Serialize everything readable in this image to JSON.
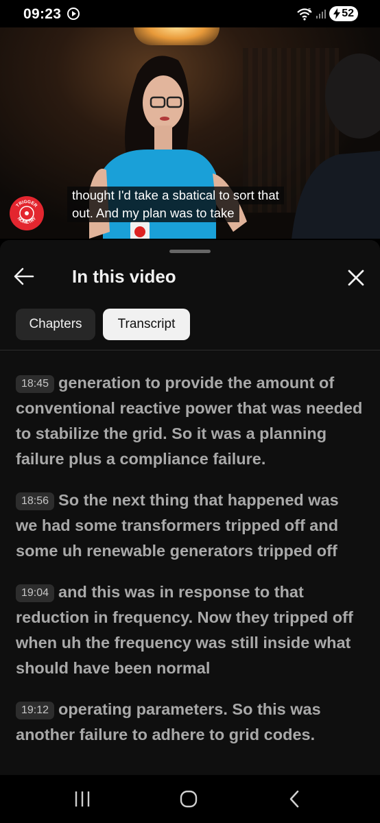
{
  "status_bar": {
    "time": "09:23",
    "battery": "52",
    "wifi_badge": "5"
  },
  "video": {
    "subtitle_lines": [
      "thought I'd take a sbatical to sort that",
      "out. And my plan was to take"
    ],
    "channel_badge_text": [
      "TRIGGER",
      "NOMETRY"
    ]
  },
  "panel": {
    "title": "In this video",
    "tabs": [
      {
        "label": "Chapters",
        "selected": false
      },
      {
        "label": "Transcript",
        "selected": true
      }
    ]
  },
  "transcript": [
    {
      "time": "18:45",
      "text": "generation to provide the amount of conventional reactive power that was needed to stabilize the grid. So it was a planning failure plus a compliance failure."
    },
    {
      "time": "18:56",
      "text": "So the next thing that happened was we had some transformers tripped off and some uh renewable generators tripped off"
    },
    {
      "time": "19:04",
      "text": "and this was in response to that reduction in frequency. Now they tripped off when uh the frequency was still inside what should have been normal"
    },
    {
      "time": "19:12",
      "text": "operating parameters. So this was another failure to adhere to grid codes."
    }
  ],
  "colors": {
    "sheet_bg": "#0f0f0f",
    "chip_selected_bg": "#f1f1f1",
    "chip_bg": "#272727",
    "channel_red": "#e3262f"
  }
}
